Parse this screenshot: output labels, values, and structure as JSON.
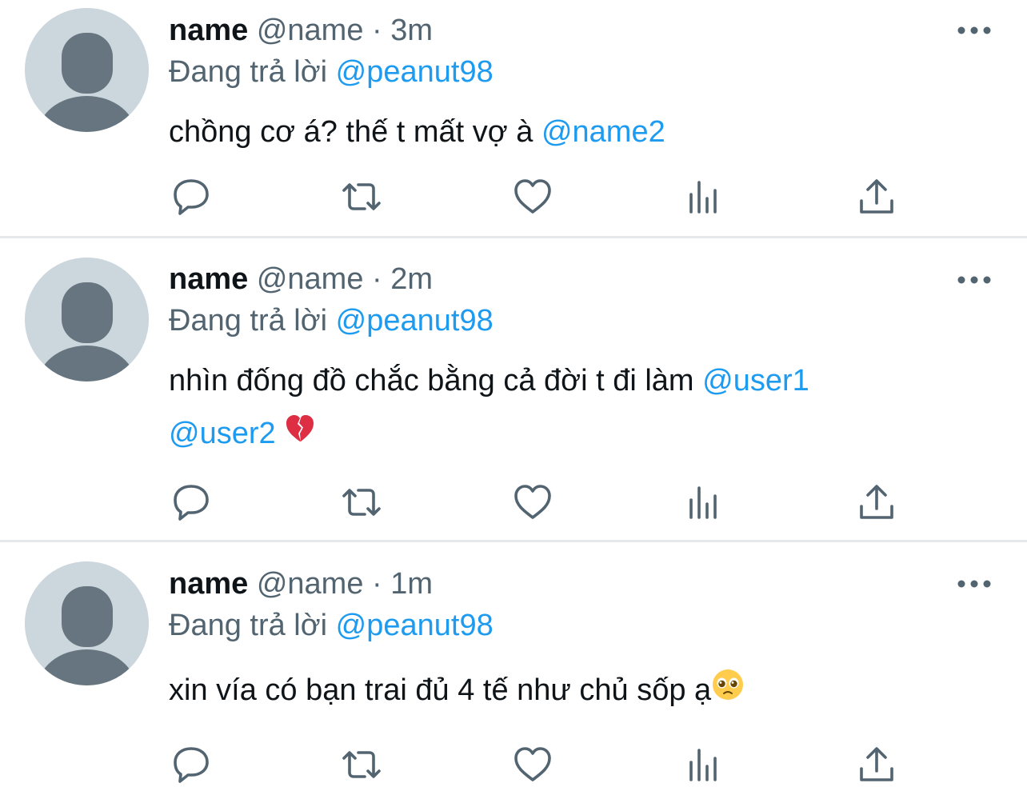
{
  "tweets": [
    {
      "display_name": "name",
      "handle": "@name",
      "separator": "·",
      "time": "3m",
      "replying_prefix": "Đang trả lời",
      "replying_to": "@peanut98",
      "text": "chồng cơ á? thế t mất vợ à",
      "text_mentions": [
        "@name2"
      ],
      "text_line2_mentions": [],
      "text_emoji": ""
    },
    {
      "display_name": "name",
      "handle": "@name",
      "separator": "·",
      "time": "2m",
      "replying_prefix": "Đang trả lời",
      "replying_to": "@peanut98",
      "text": "nhìn đống đồ chắc bằng cả đời t đi làm",
      "text_mentions": [
        "@user1"
      ],
      "text_line2_mentions": [
        "@user2"
      ],
      "text_emoji": "broken-heart-emoji"
    },
    {
      "display_name": "name",
      "handle": "@name",
      "separator": "·",
      "time": "1m",
      "replying_prefix": "Đang trả lời",
      "replying_to": "@peanut98",
      "text": "xin vía có bạn trai đủ 4 tế như chủ sốp ạ",
      "text_mentions": [],
      "text_line2_mentions": [],
      "text_emoji": "pleading-face-emoji"
    }
  ],
  "icons": {
    "reply": "reply-icon",
    "retweet": "retweet-icon",
    "like": "like-icon",
    "analytics": "analytics-icon",
    "share": "share-icon",
    "more": "more-icon"
  },
  "colors": {
    "mention": "#1d9bf0",
    "secondary_text": "#536471",
    "primary_text": "#0f1419",
    "avatar_bg": "#ccd6dd",
    "avatar_fg": "#66757f",
    "divider": "#e6e9eb"
  }
}
